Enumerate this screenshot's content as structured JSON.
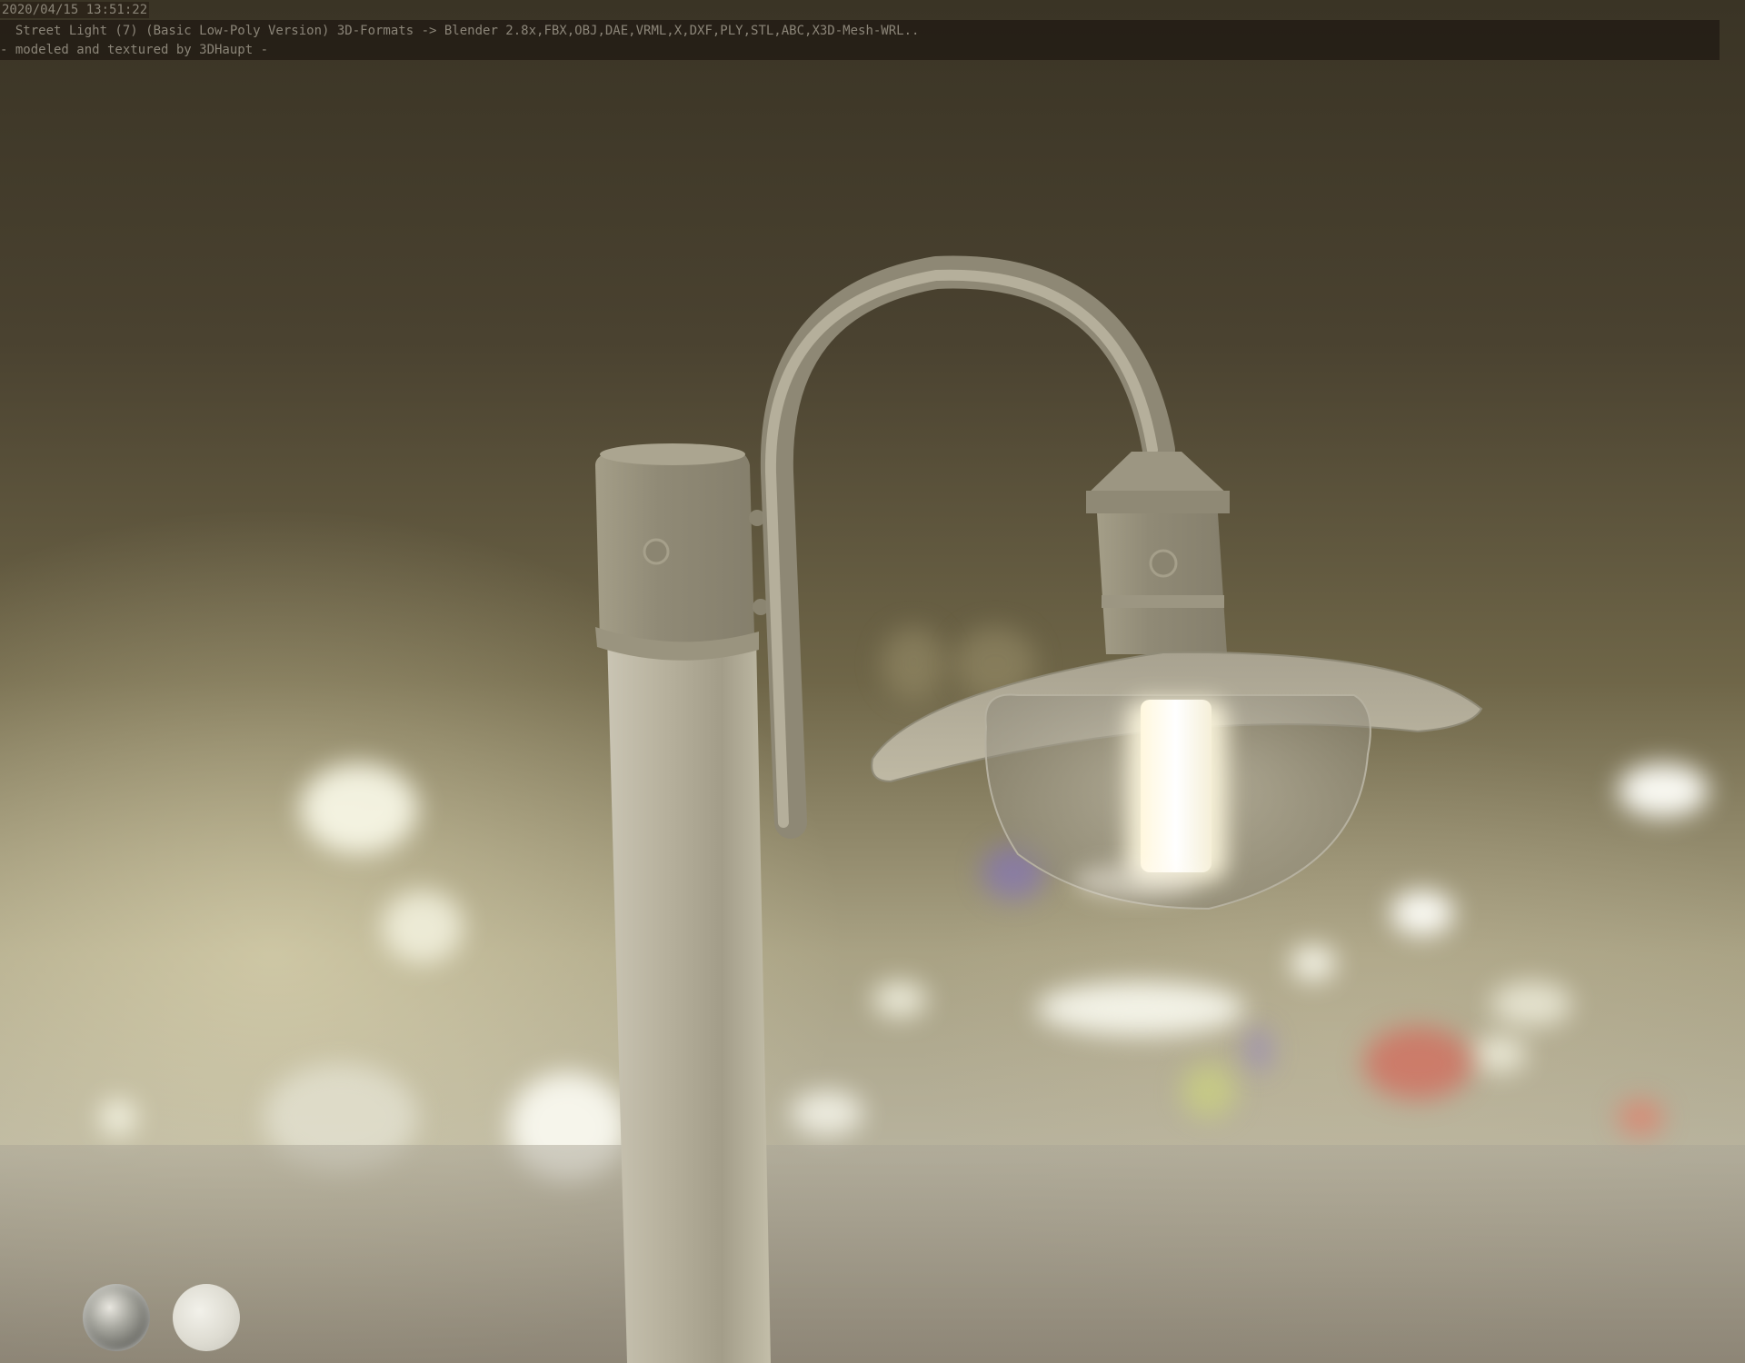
{
  "viewer": {
    "timestamp": "2020/04/15 13:51:22",
    "title": "  Street Light (7) (Basic Low-Poly Version) 3D-Formats -> Blender 2.8x,FBX,OBJ,DAE,VRML,X,DXF,PLY,STL,ABC,X3D-Mesh-WRL..",
    "credit": "- modeled and textured by 3DHaupt -"
  },
  "scene": {
    "subject": "street-lamp-model",
    "icons": [
      "environment-sphere-icon",
      "matte-sphere-icon"
    ]
  },
  "colors": {
    "overlay_text": "#8b8578",
    "overlay_bar": "#1e1812",
    "lamp_metal": "#a8a290",
    "lamp_glow": "#fffdf0"
  }
}
